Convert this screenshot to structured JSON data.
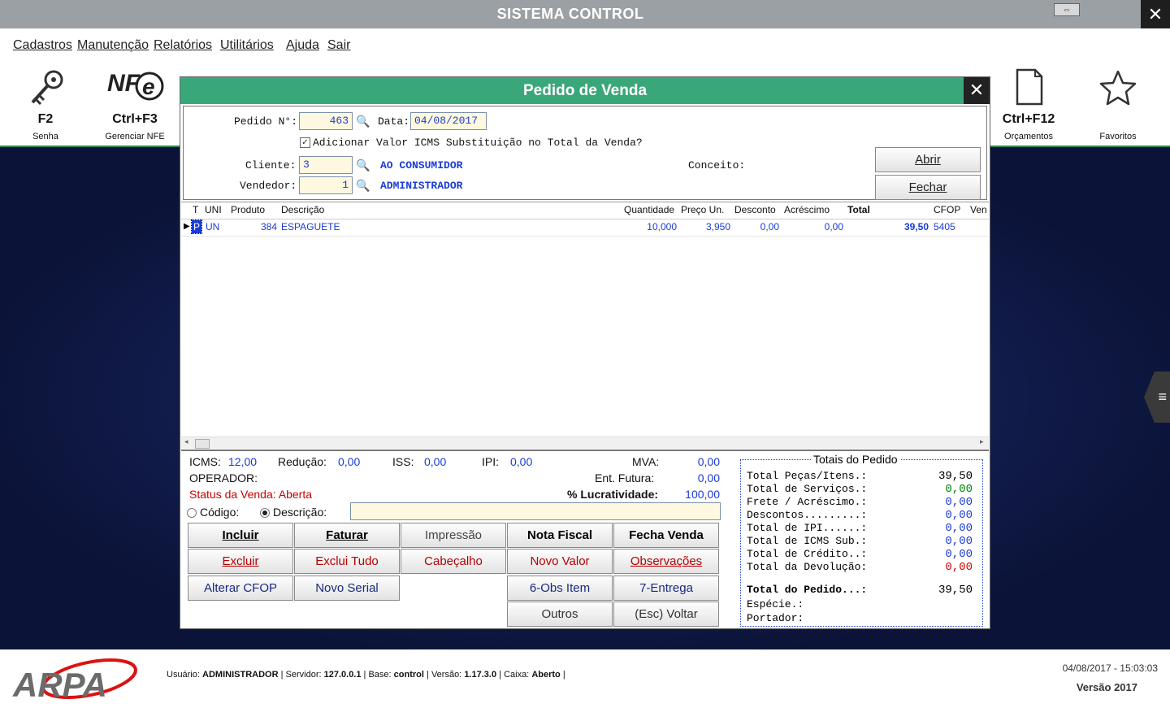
{
  "window": {
    "title": "SISTEMA CONTROL",
    "close_glyph": "✕",
    "restore_glyph": "⇔"
  },
  "menu": [
    "Cadastros",
    "Manutenção",
    "Relatórios",
    "Utilitários",
    "Ajuda",
    "Sair"
  ],
  "toolbar": {
    "senha": {
      "key": "F2",
      "label": "Senha"
    },
    "nfe": {
      "key": "Ctrl+F3",
      "label": "Gerenciar NFE",
      "logo": "NFe"
    },
    "orcamentos": {
      "key": "Ctrl+F12",
      "label": "Orçamentos"
    },
    "favoritos": {
      "key": "",
      "label": "Favoritos"
    }
  },
  "dialog": {
    "title": "Pedido de Venda",
    "close_glyph": "✕",
    "pedido_label": "Pedido N°:",
    "pedido_value": "463",
    "data_label": "Data:",
    "data_value": "04/08/2017",
    "icms_st_label": "Adicionar Valor ICMS Substituição no Total da Venda?",
    "icms_st_checked": true,
    "cliente_label": "Cliente:",
    "cliente_code": "3",
    "cliente_name": "AO CONSUMIDOR",
    "vendedor_label": "Vendedor:",
    "vendedor_code": "1",
    "vendedor_name": "ADMINISTRADOR",
    "conceito_label": "Conceito:",
    "abrir": "Abrir",
    "fechar": "Fechar"
  },
  "grid": {
    "headers": [
      "T",
      "UNI",
      "Produto",
      "Descrição",
      "Quantidade",
      "Preço Un.",
      "Desconto",
      "Acréscimo",
      "Total",
      "CFOP",
      "Ven"
    ],
    "row": {
      "t": "P",
      "uni": "UN",
      "produto": "384",
      "descricao": "ESPAGUETE",
      "quantidade": "10,000",
      "preco": "3,950",
      "desconto": "0,00",
      "acrescimo": "0,00",
      "total": "39,50",
      "cfop": "5405"
    }
  },
  "info": {
    "icms_label": "ICMS:",
    "icms": "12,00",
    "reducao_label": "Redução:",
    "reducao": "0,00",
    "iss_label": "ISS:",
    "iss": "0,00",
    "ipi_label": "IPI:",
    "ipi": "0,00",
    "mva_label": "MVA:",
    "mva": "0,00",
    "operador_label": "OPERADOR:",
    "ent_futura_label": "Ent. Futura:",
    "ent_futura": "0,00",
    "status": "Status da Venda: Aberta",
    "lucratividade_label": "% Lucratividade:",
    "lucratividade": "100,00",
    "codigo_label": "Código:",
    "descricao_label": "Descrição:"
  },
  "buttons": {
    "incluir": "Incluir",
    "faturar": "Faturar",
    "impressao": "Impressão",
    "nota_fiscal": "Nota Fiscal",
    "fecha_venda": "Fecha Venda",
    "excluir": "Excluir",
    "exclui_tudo": "Exclui Tudo",
    "cabecalho": "Cabeçalho",
    "novo_valor": "Novo Valor",
    "observacoes": "Observações",
    "alterar_cfop": "Alterar CFOP",
    "novo_serial": "Novo Serial",
    "obs_item": "6-Obs Item",
    "entrega": "7-Entrega",
    "outros": "Outros",
    "voltar": "(Esc) Voltar"
  },
  "totais": {
    "title": "Totais do Pedido",
    "rows": [
      {
        "label": "Total Peças/Itens.:",
        "value": "39,50",
        "color": "#000000"
      },
      {
        "label": "Total de Serviços.:",
        "value": "0,00",
        "color": "#008000"
      },
      {
        "label": "Frete / Acréscimo.:",
        "value": "0,00",
        "color": "#1a3bd6"
      },
      {
        "label": "Descontos.........:",
        "value": "0,00",
        "color": "#1a3bd6"
      },
      {
        "label": "Total de IPI......:",
        "value": "0,00",
        "color": "#1a3bd6"
      },
      {
        "label": "Total de ICMS Sub.:",
        "value": "0,00",
        "color": "#1a3bd6"
      },
      {
        "label": "Total de Crédito..:",
        "value": "0,00",
        "color": "#1a3bd6"
      },
      {
        "label": "Total da Devolução:",
        "value": "0,00",
        "color": "#dd0000"
      }
    ],
    "pedido_label": "Total do Pedido...:",
    "pedido_value": "39,50",
    "especie_label": "Espécie.:",
    "portador_label": "Portador:"
  },
  "statusbar": {
    "logo": "ARPA",
    "usuario_label": "Usuário:",
    "usuario": "ADMINISTRADOR",
    "servidor_label": "Servidor:",
    "servidor": "127.0.0.1",
    "base_label": "Base:",
    "base": "control",
    "versao_label": "Versão:",
    "versao": "1.17.3.0",
    "caixa_label": "Caixa:",
    "caixa": "Aberto",
    "datetime": "04/08/2017 - 15:03:03",
    "versao_year": "Versão 2017"
  }
}
